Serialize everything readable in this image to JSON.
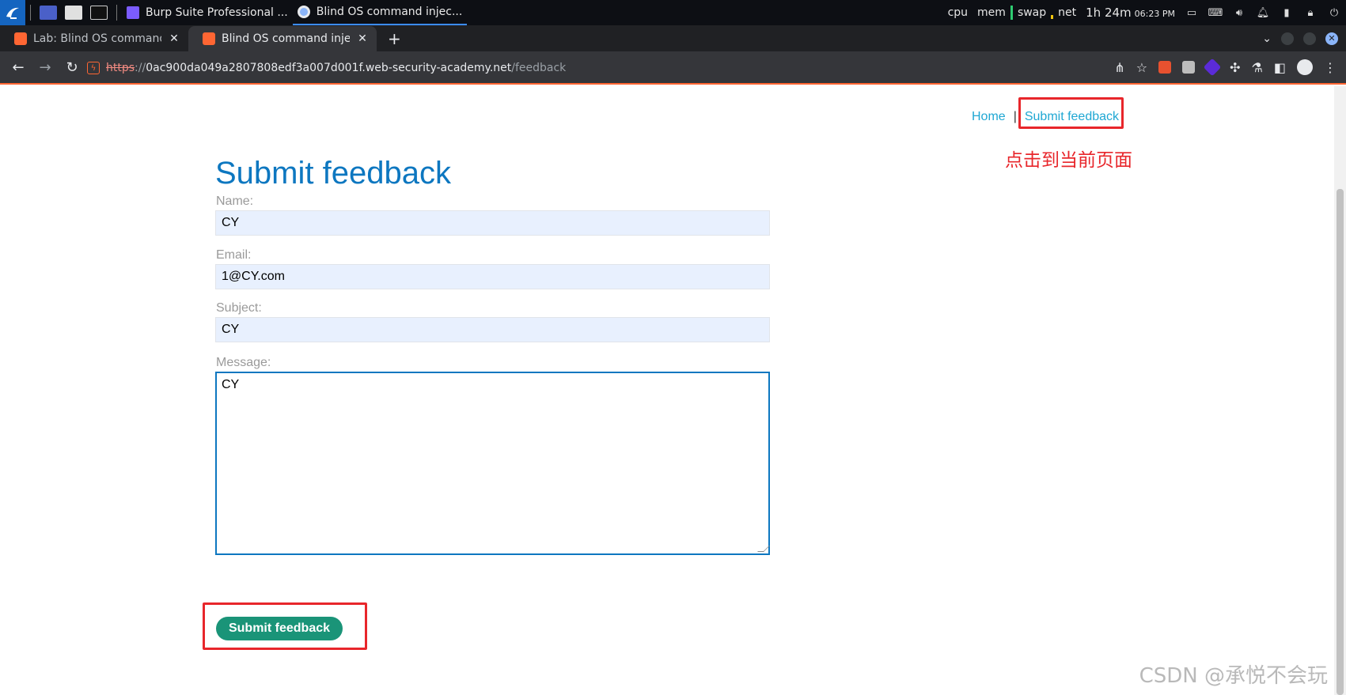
{
  "os_panel": {
    "tasks": [
      {
        "label": "Burp Suite Professional ...",
        "active": false
      },
      {
        "label": "Blind OS command injec...",
        "active": true
      }
    ],
    "stats": [
      "cpu",
      "mem",
      "swap",
      "net"
    ],
    "uptime": "1h 24m",
    "time": "06:23 PM"
  },
  "browser": {
    "tabs": [
      {
        "title": "Lab: Blind OS command in",
        "active": false
      },
      {
        "title": "Blind OS command injectio",
        "active": true
      }
    ],
    "new_tab_symbol": "+",
    "url": {
      "scheme": "https",
      "separator": "://",
      "host": "0ac900da049a2807808edf3a007d001f.web-security-academy.net",
      "path": "/feedback"
    }
  },
  "page": {
    "nav": {
      "home": "Home",
      "separator": "|",
      "submit_feedback": "Submit feedback"
    },
    "annotation_text": "点击到当前页面",
    "title": "Submit feedback",
    "form": {
      "name_label": "Name:",
      "name_value": "CY",
      "email_label": "Email:",
      "email_value": "1@CY.com",
      "subject_label": "Subject:",
      "subject_value": "CY",
      "message_label": "Message:",
      "message_value": "CY",
      "submit_label": "Submit feedback"
    },
    "watermark": "CSDN @承悦不会玩"
  },
  "colors": {
    "title_blue": "#0d77c0",
    "link_blue": "#1fa7d3",
    "button_green": "#1a9478",
    "annotation_red": "#e8262b",
    "input_bg": "#e8f0fe"
  }
}
